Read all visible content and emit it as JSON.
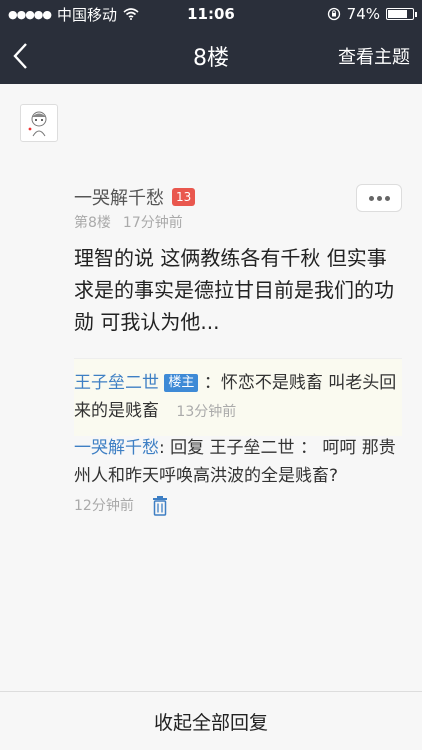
{
  "status_bar": {
    "carrier": "中国移动",
    "time": "11:06",
    "battery": "74%"
  },
  "nav": {
    "title": "8楼",
    "right_action": "查看主题"
  },
  "post": {
    "author": "一哭解千愁",
    "level": "13",
    "floor": "第8楼",
    "time": "17分钟前",
    "content": "理智的说 这俩教练各有千秋 但实事求是的事实是德拉甘目前是我们的功勋 可我认为他..."
  },
  "replies": [
    {
      "user": "王子垒二世",
      "badge": "楼主",
      "text": "：怀恋不是贱畜 叫老头回来的是贱畜",
      "time": "13分钟前"
    },
    {
      "user": "一哭解千愁",
      "text": ": 回复 王子垒二世 ： 呵呵 那贵州人和昨天呼唤高洪波的全是贱畜?",
      "time": "12分钟前"
    }
  ],
  "bottom": {
    "label": "收起全部回复"
  }
}
